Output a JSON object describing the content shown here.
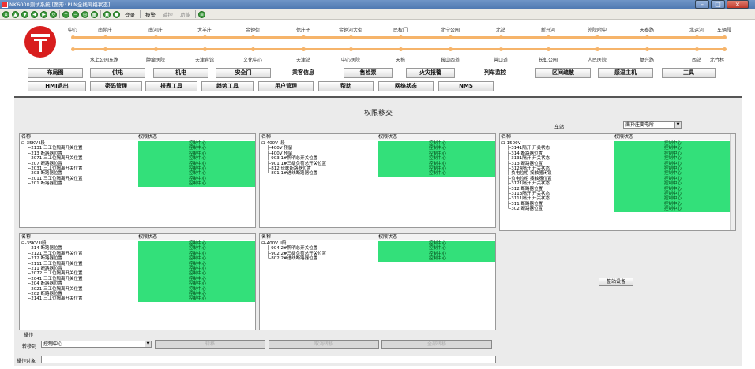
{
  "window": {
    "title": "NK6000测试系统   [图形: PLN全线网络状态]"
  },
  "toolbar": {
    "items": [
      "登录",
      "报警",
      "遥控",
      "功能"
    ]
  },
  "logo": {
    "name": "metro-logo-icon"
  },
  "line": {
    "top_stations": [
      "中心",
      "南苑庄",
      "南河庄",
      "大羊庄",
      "金钟街",
      "徐庄子",
      "金钟河大街",
      "民权门",
      "北宁公园",
      "北站",
      "新开河",
      "外院附中",
      "天泰路",
      "北运河",
      "车辆段"
    ],
    "bottom_stations": [
      "水上公园东路",
      "肿瘤医院",
      "天津宾馆",
      "文化中心",
      "天津站",
      "中心医院",
      "天拖",
      "鞍山西道",
      "营口道",
      "长虹公园",
      "人民医院",
      "复兴路",
      "西站",
      "北竹林"
    ],
    "color": "#f6b46a"
  },
  "nav_row1": [
    "布局图",
    "供电",
    "机电",
    "安全门",
    "乘客信息",
    "售检票",
    "火灾报警",
    "列车监控",
    "区间疏散",
    "感温主机",
    "工具"
  ],
  "nav_row2": [
    "HMI退出",
    "密码管理",
    "报表工具",
    "趋势工具",
    "用户管理",
    "帮助",
    "网络状态",
    "NMS"
  ],
  "main": {
    "title": "权限移交",
    "station_label": "车站",
    "station_value": "南孙庄变电所",
    "col_name": "名称",
    "col_status": "权限状态",
    "status_value": "控制中心",
    "status_color": "#33e07a",
    "panels": [
      {
        "root": "35KV I段",
        "items": [
          "2131 三工位隔离开关位置",
          "213 断路器位置",
          "2071 三工位隔离开关位置",
          "207 断路器位置",
          "2031 三工位隔离开关位置",
          "203 断路器位置",
          "2011 三工位隔离开关位置",
          "201 断路器位置"
        ]
      },
      {
        "root": "400V I段",
        "items": [
          "400V 预留",
          "400V 预留",
          "903 1#照明总开关位置",
          "901 1#三级负荷总开关位置",
          "812 母联断路器位置",
          "801 1#进线断路器位置"
        ]
      },
      {
        "root": "1500V",
        "items": [
          "3141隔开 开关状态",
          "314 断路器位置",
          "3131隔开 开关状态",
          "313 断路器位置",
          "3124隔开 开关状态",
          "负电位柜 接触器闭锁",
          "负电位柜 接触器位置",
          "3121隔开 开关状态",
          "312 断路器位置",
          "3113隔开 开关状态",
          "3111隔开 开关状态",
          "311 断路器位置",
          "302 断路器位置"
        ]
      },
      {
        "root": "35KV II段",
        "items": [
          "214 断路器位置",
          "2121 三工位隔离开关位置",
          "212 断路器位置",
          "2111 三工位隔离开关位置",
          "211 断路器位置",
          "2072 三工位隔离开关位置",
          "2041 三工位隔离开关位置",
          "204 断路器位置",
          "2021 三工位隔离开关位置",
          "202 断路器位置",
          "2141 三工位隔离开关位置"
        ]
      },
      {
        "root": "400V II段",
        "items": [
          "904 2#照明总开关位置",
          "902 2#三级负荷总开关位置",
          "802 2#进线断路器位置"
        ]
      }
    ],
    "whole_station_button": "整站设备",
    "operation_group": "操作",
    "transfer_label": "转移到",
    "transfer_value": "控制中心",
    "btn_transfer": "转移",
    "btn_cancel": "取消转移",
    "btn_confirm": "全部转移",
    "target_label": "操作对象"
  }
}
